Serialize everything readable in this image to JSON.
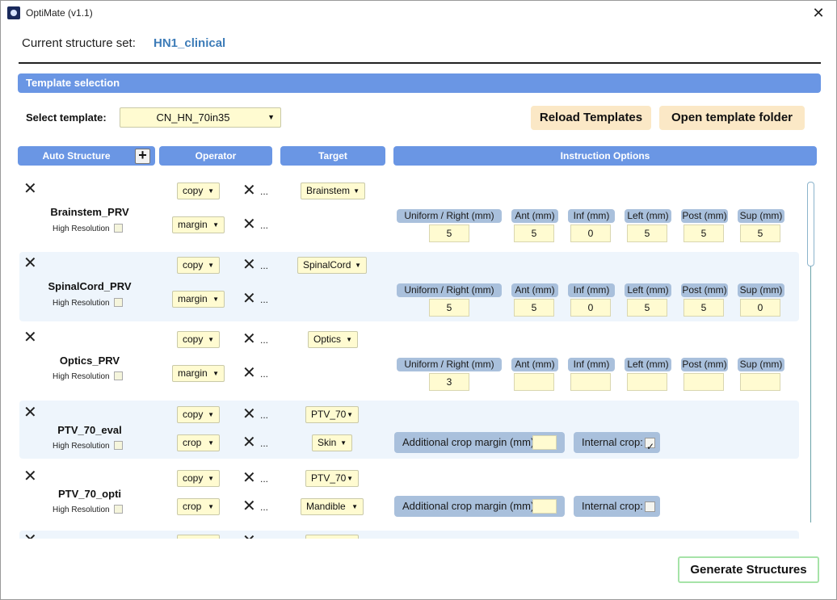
{
  "window": {
    "title": "OptiMate (v1.1)",
    "close_symbol": "✕"
  },
  "structure_set": {
    "label": "Current structure set:",
    "value": "HN1_clinical"
  },
  "template_section": {
    "header": "Template selection",
    "select_label": "Select template:",
    "selected_template": "CN_HN_70in35",
    "reload_label": "Reload Templates",
    "open_folder_label": "Open template folder"
  },
  "columns": {
    "auto_structure": "Auto Structure",
    "operator": "Operator",
    "target": "Target",
    "instruction_options": "Instruction Options",
    "add_symbol": "+"
  },
  "common": {
    "delete_symbol": "✕",
    "ellipsis": "...",
    "high_resolution": "High Resolution",
    "dropdown_arrow": "▼"
  },
  "margin_labels": [
    "Uniform / Right (mm)",
    "Ant (mm)",
    "Inf (mm)",
    "Left (mm)",
    "Post (mm)",
    "Sup (mm)"
  ],
  "crop_labels": {
    "additional": "Additional crop margin (mm):",
    "internal": "Internal crop:"
  },
  "rows": [
    {
      "name": "Brainstem_PRV",
      "high_res": false,
      "op1": "copy",
      "target1": "Brainstem",
      "op2": "margin",
      "margins": [
        "5",
        "5",
        "0",
        "5",
        "5",
        "5"
      ]
    },
    {
      "name": "SpinalCord_PRV",
      "high_res": false,
      "op1": "copy",
      "target1": "SpinalCord",
      "op2": "margin",
      "margins": [
        "5",
        "5",
        "0",
        "5",
        "5",
        "0"
      ]
    },
    {
      "name": "Optics_PRV",
      "high_res": false,
      "op1": "copy",
      "target1": "Optics",
      "op2": "margin",
      "margins": [
        "3",
        "",
        "",
        "",
        "",
        ""
      ]
    },
    {
      "name": "PTV_70_eval",
      "high_res": false,
      "op1": "copy",
      "target1": "PTV_70",
      "op2": "crop",
      "target2": "Skin",
      "additional_margin": "",
      "internal_crop": true
    },
    {
      "name": "PTV_70_opti",
      "high_res": false,
      "op1": "copy",
      "target1": "PTV_70",
      "op2": "crop",
      "target2": "Mandible",
      "additional_margin": "",
      "internal_crop": false
    }
  ],
  "generate_label": "Generate Structures"
}
